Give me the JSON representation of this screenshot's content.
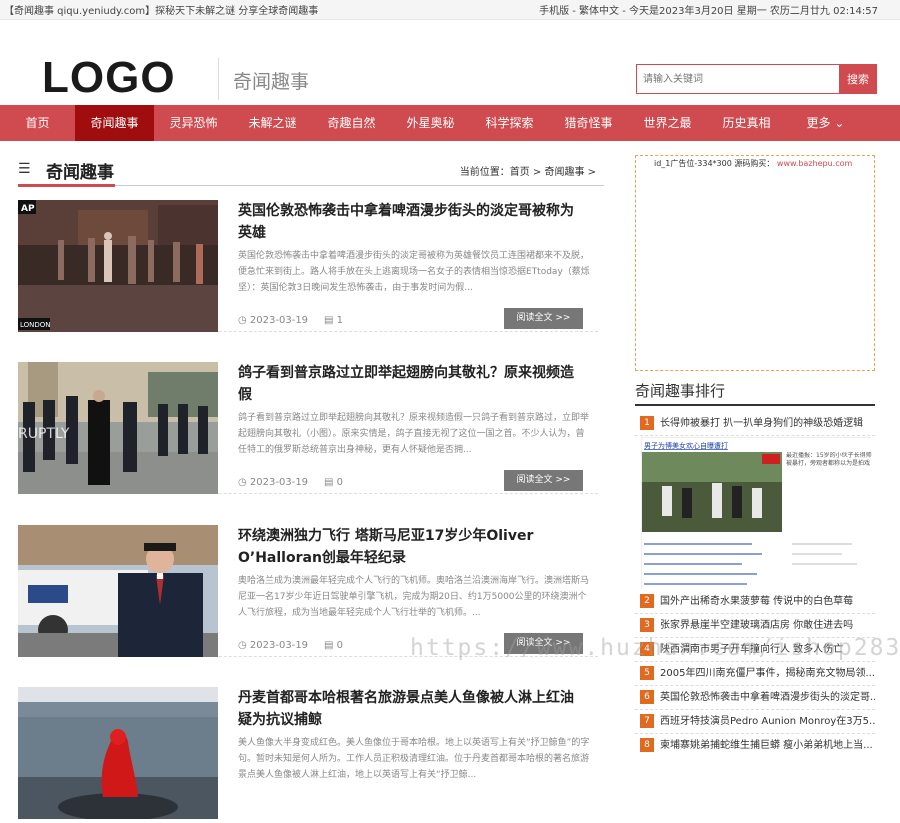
{
  "topbar": {
    "left": "【奇闻趣事 qiqu.yeniudy.com】探秘天下未解之谜 分享全球奇闻趣事",
    "right": "手机版 - 繁体中文 - 今天是2023年3月20日 星期一 农历二月廿九 02:14:57"
  },
  "header": {
    "logo": "LOGO",
    "slogan": "奇闻趣事",
    "search_placeholder": "请输入关键词",
    "search_button": "搜索"
  },
  "nav": [
    "首页",
    "奇闻趣事",
    "灵异恐怖",
    "未解之谜",
    "奇趣自然",
    "外星奥秘",
    "科学探索",
    "猎奇怪事",
    "世界之最",
    "历史真相",
    "更多"
  ],
  "page_title": {
    "title": "奇闻趣事",
    "breadcrumb": "当前位置：首页 > 奇闻趣事 >"
  },
  "articles": [
    {
      "title": "英国伦敦恐怖袭击中拿着啤酒漫步街头的淡定哥被称为英雄",
      "summary": "英国伦敦恐怖袭击中拿着啤酒漫步街头的淡定哥被称为英雄餐饮员工连围裙都来不及脱，便急忙来到街上。路人将手放在头上逃离现场一名女子的表情相当惊恐据ETtoday（蔡烁坚）：英国伦敦3日晚间发生恐怖袭击，由于事发时间为假...",
      "date": "2023-03-19",
      "views": "1",
      "more": "阅读全文 >>",
      "img_text": "AP",
      "img_sub": "LONDON"
    },
    {
      "title": "鸽子看到普京路过立即举起翅膀向其敬礼？原来视频造假",
      "summary": "鸽子看到普京路过立即举起翅膀向其敬礼？原来视频造假一只鸽子看到普京路过，立即举起翅膀向其敬礼（小图）。原来实情是，鸽子直接无视了这位一国之首。不少人认为，曾任特工的俄罗斯总统普京出身神秘，更有人怀疑他是否拥...",
      "date": "2023-03-19",
      "views": "0",
      "more": "阅读全文 >>",
      "img_text": "RUPTLY"
    },
    {
      "title": "环绕澳洲独力飞行 塔斯马尼亚17岁少年Oliver O’Halloran创最年轻纪录",
      "summary": "奥哈洛兰成为澳洲最年轻完成个人飞行的飞机师。奥哈洛兰沿澳洲海岸飞行。澳洲塔斯马尼亚一名17岁少年近日驾驶单引擎飞机，完成为期20日、约1万5000公里的环绕澳洲个人飞行旅程，成为当地最年轻完成个人飞行壮举的飞机师。...",
      "date": "2023-03-19",
      "views": "0",
      "more": "阅读全文 >>"
    },
    {
      "title": "丹麦首都哥本哈根著名旅游景点美人鱼像被人淋上红油疑为抗议捕鲸",
      "summary": "美人鱼像大半身变成红色。美人鱼像位于哥本哈根。地上以英语写上有关“抒卫鲸鱼”的字句。暂时未知是何人所为。工作人员正积极清理红油。位于丹麦首都哥本哈根的著名旅游景点美人鱼像被人淋上红油，地上以英语写上有关“抒卫鲸...",
      "date": "",
      "views": "",
      "more": ""
    }
  ],
  "sidebar": {
    "ad_text": "id_1广告位-334*300 源码购买：",
    "ad_url": "www.bazhepu.com",
    "rank_title": "奇闻趣事排行",
    "rank_items": [
      {
        "n": "1",
        "t": "长得帅被暴打 扒一扒单身狗们的神级恐婚逻辑"
      },
      {
        "n": "2",
        "t": "国外产出稀奇水果菠萝莓 传说中的白色草莓"
      },
      {
        "n": "3",
        "t": "张家界悬崖半空建玻璃酒店房 你敢住进去吗"
      },
      {
        "n": "4",
        "t": "陕西渭南市男子开车撞向行人 致多人伤亡"
      },
      {
        "n": "5",
        "t": "2005年四川南充僵尸事件，揭秘南充文物局领..."
      },
      {
        "n": "6",
        "t": "英国伦敦恐怖袭击中拿着啤酒漫步街头的淡定哥..."
      },
      {
        "n": "7",
        "t": "西班牙特技演员Pedro Aunion Monroy在3万5..."
      },
      {
        "n": "8",
        "t": "柬埔寨姚弟捕蛇维生捕巨蟒 瘦小弟弟机地上当..."
      }
    ],
    "rank_image_caption": "男子为博美女欢心自曝遭打",
    "rank_image_side": "最近播报：15岁的小伙子长得帅被暴打，旁观者都称以为是拍戏"
  },
  "watermark": "https://www.huzhan.com/ishop2831"
}
